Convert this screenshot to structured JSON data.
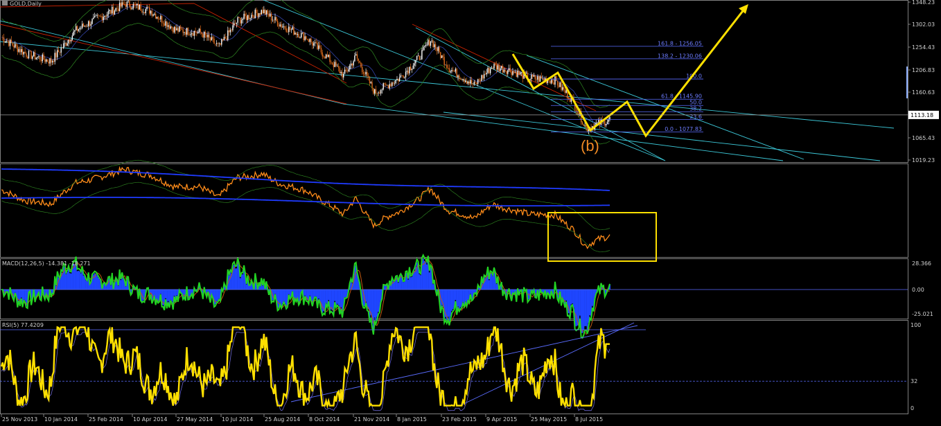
{
  "window_title": "GOLD,Daily",
  "chart_data": [
    {
      "type": "candlestick",
      "title": "GOLD,Daily",
      "ylim": [
        1000,
        1350
      ],
      "price_axis_ticks": [
        "1348.23",
        "1302.03",
        "1254.43",
        "1206.83",
        "1160.63",
        "1113.18",
        "1065.43",
        "1019.23"
      ],
      "current_price": "1113.18",
      "wave_label": "(b)",
      "x_tick_labels": [
        "25 Nov 2013",
        "10 Jan 2014",
        "25 Feb 2014",
        "10 Apr 2014",
        "27 May 2014",
        "10 Jul 2014",
        "25 Aug 2014",
        "8 Oct 2014",
        "21 Nov 2014",
        "8 Jan 2015",
        "23 Feb 2015",
        "9 Apr 2015",
        "25 May 2015",
        "8 Jul 2015"
      ],
      "fibonacci_levels": [
        {
          "label": "161.8 - 1256.05",
          "value": 1256.05
        },
        {
          "label": "138.2 - 1230.06",
          "value": 1230.06
        },
        {
          "label": "100.0",
          "value": 1188.0
        },
        {
          "label": "61.8 - 1145.90",
          "value": 1145.9
        },
        {
          "label": "50.0",
          "value": 1132.9
        },
        {
          "label": "38.2",
          "value": 1119.9
        },
        {
          "label": "23.6",
          "value": 1103.8
        },
        {
          "label": "0.0 - 1077.83",
          "value": 1077.83
        }
      ],
      "colors": {
        "bull": "#ffffff",
        "bear": "#e06c1c",
        "fib": "#5a6cff",
        "trend": "#3cc8d8",
        "projection": "#ffe000"
      }
    },
    {
      "type": "line",
      "title": "",
      "series": [
        {
          "name": "",
          "color": "#ff8c1a"
        },
        {
          "name": "",
          "color": "#1f3bff"
        }
      ],
      "highlight_box_color": "#ffe000"
    },
    {
      "type": "line",
      "title": "MACD(12,26,5) -14.381 -18.271",
      "macd": -14.381,
      "signal": -18.271,
      "axis_ticks": [
        "28.366",
        "0.00",
        "-25.021"
      ],
      "colors": {
        "macd_line": "#22d422",
        "histogram": "#1f46ff"
      }
    },
    {
      "type": "line",
      "title": "RSI(5) 77.4209",
      "value": 77.4209,
      "axis_ticks": [
        "100",
        "32",
        "0"
      ],
      "colors": {
        "rsi_line": "#ffe000",
        "other": "#6a66cc"
      }
    }
  ]
}
